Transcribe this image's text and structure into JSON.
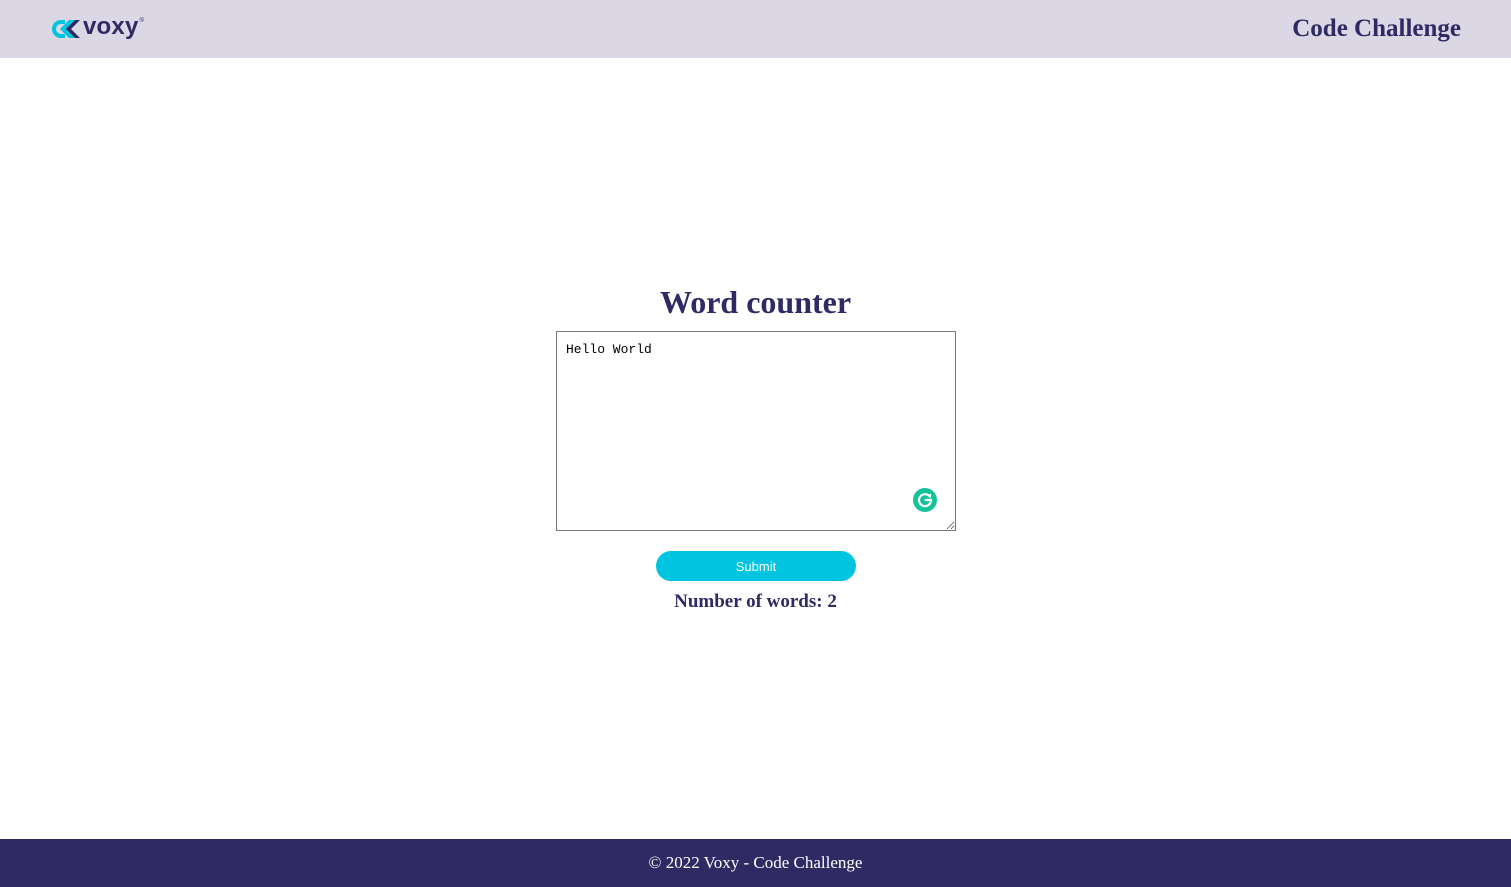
{
  "header": {
    "logo_text": "voxy",
    "logo_registered": "®",
    "title": "Code Challenge"
  },
  "main": {
    "title": "Word counter",
    "textarea_value": "Hello World",
    "submit_label": "Submit",
    "result_label": "Number of words:",
    "result_value": "2"
  },
  "footer": {
    "text": "© 2022 Voxy - Code Challenge"
  },
  "colors": {
    "header_bg": "#dbd7e4",
    "brand_navy": "#2f2a64",
    "brand_cyan": "#00c4e0",
    "grammarly_green": "#15c39a",
    "footer_bg": "#2f2a64"
  },
  "icons": {
    "logo_mark": "voxy-logo-icon",
    "grammarly": "grammarly-icon"
  }
}
